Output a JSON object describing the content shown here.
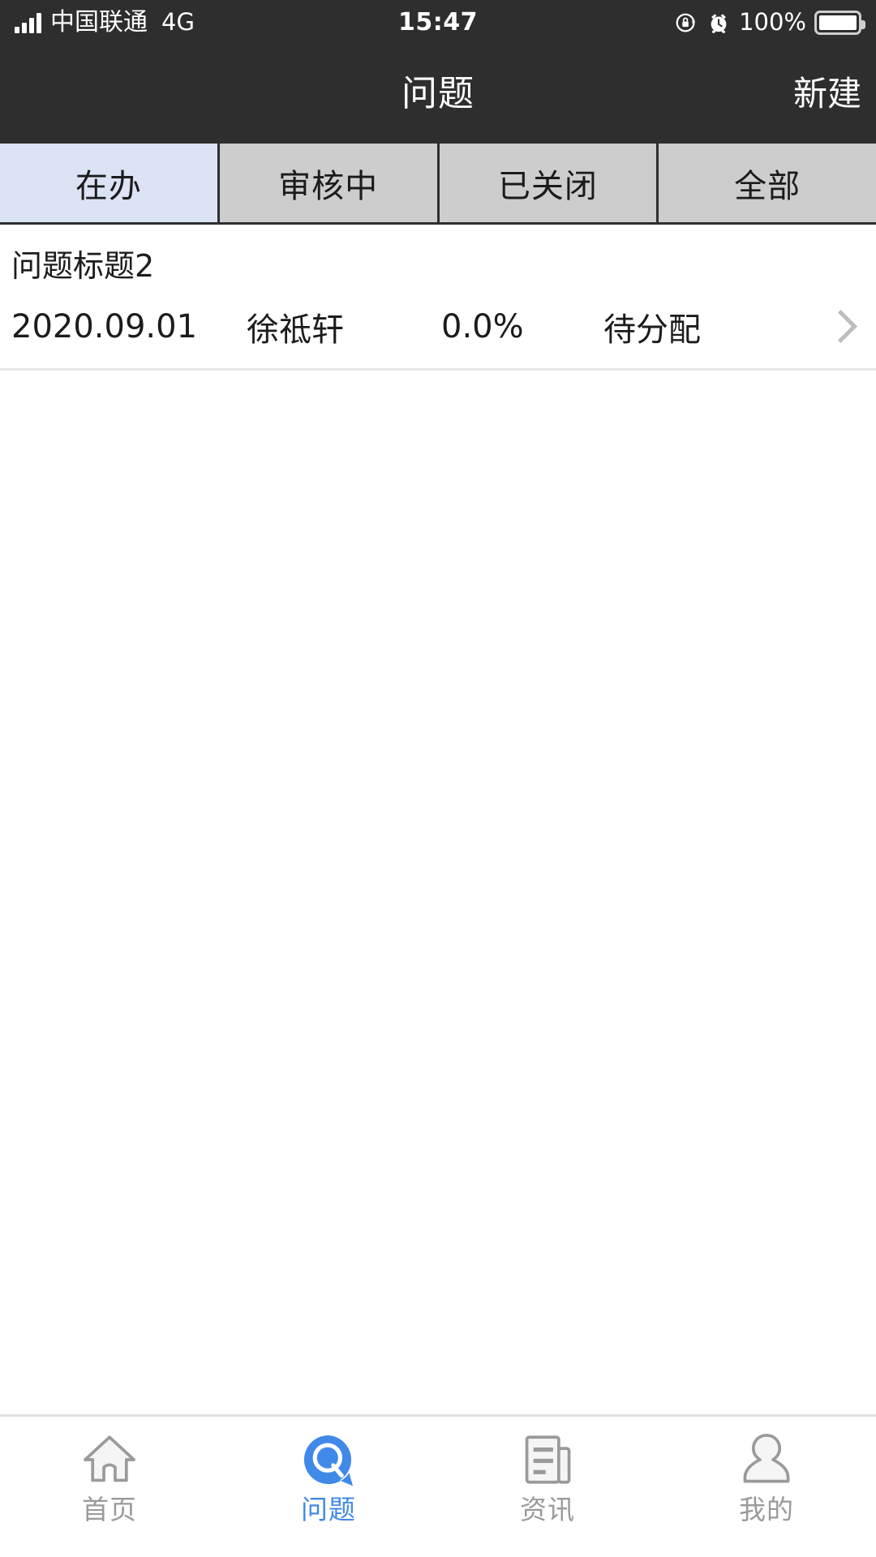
{
  "status_bar": {
    "carrier": "中国联通",
    "network": "4G",
    "time": "15:47",
    "battery_percent": "100%",
    "signal_icon": "signal-bars-icon",
    "rotation_lock_icon": "rotation-lock-icon",
    "alarm_icon": "alarm-clock-icon",
    "battery_icon": "battery-full-icon"
  },
  "nav_bar": {
    "title": "问题",
    "action_label": "新建"
  },
  "tabs": [
    {
      "label": "在办",
      "active": true
    },
    {
      "label": "审核中",
      "active": false
    },
    {
      "label": "已关闭",
      "active": false
    },
    {
      "label": "全部",
      "active": false
    }
  ],
  "list": [
    {
      "title": "问题标题2",
      "date": "2020.09.01",
      "person": "徐祗轩",
      "progress": "0.0%",
      "status": "待分配",
      "chevron_icon": "chevron-right-icon"
    }
  ],
  "tabbar": [
    {
      "label": "首页",
      "icon": "home-icon",
      "active": false
    },
    {
      "label": "问题",
      "icon": "question-bubble-icon",
      "active": true
    },
    {
      "label": "资讯",
      "icon": "news-icon",
      "active": false
    },
    {
      "label": "我的",
      "icon": "profile-icon",
      "active": false
    }
  ],
  "colors": {
    "bar_background": "#2e2e2e",
    "tab_inactive": "#cdcdcd",
    "tab_active": "#dce3f5",
    "accent": "#4089e8",
    "muted_text": "#9a9a9a"
  }
}
